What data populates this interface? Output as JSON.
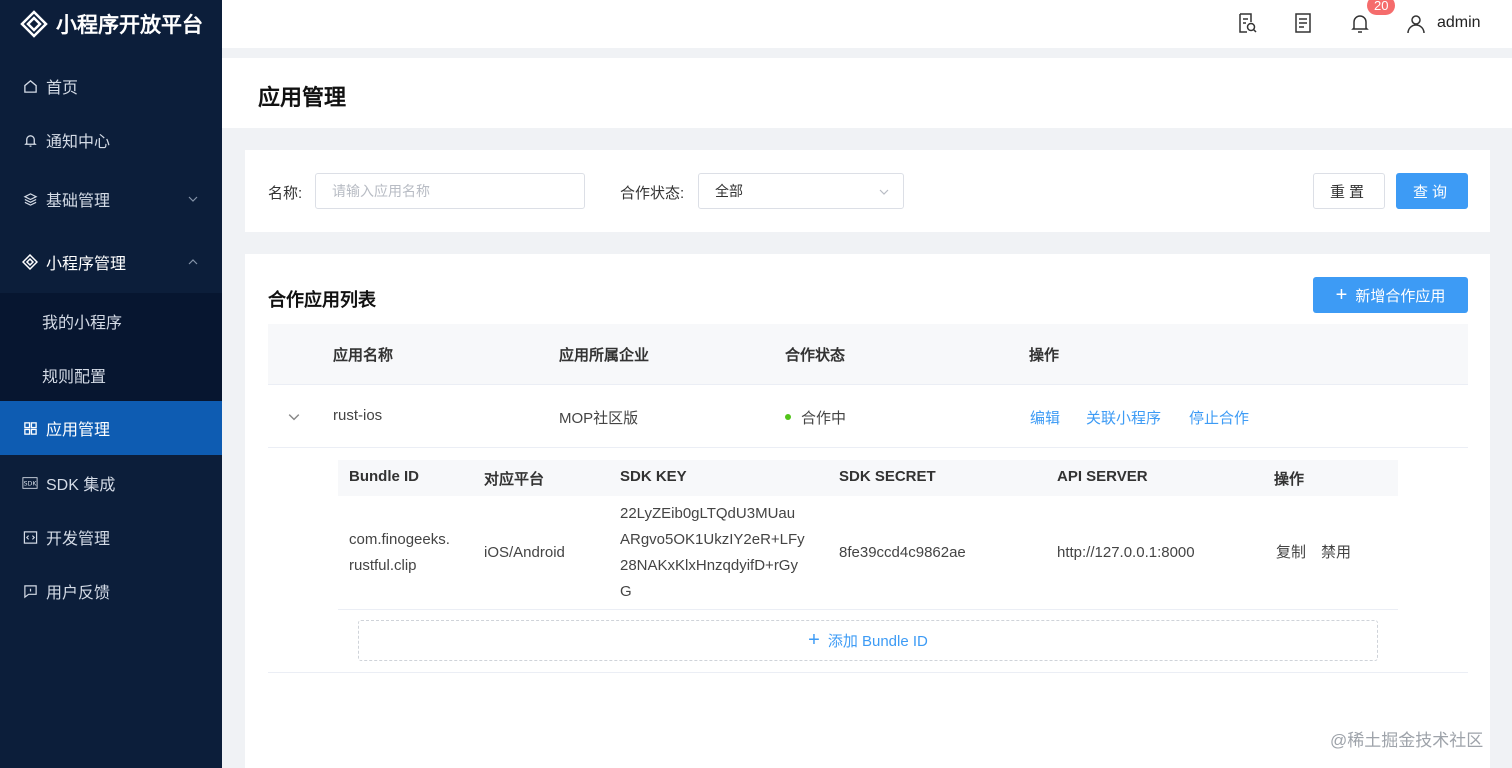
{
  "app": {
    "title": "小程序开放平台"
  },
  "sidebar": {
    "items": [
      {
        "label": "首页",
        "icon": "home-icon"
      },
      {
        "label": "通知中心",
        "icon": "bell-icon"
      },
      {
        "label": "基础管理",
        "icon": "layers-icon"
      },
      {
        "label": "小程序管理",
        "icon": "mini-program-icon"
      },
      {
        "label": "应用管理",
        "icon": "grid-icon"
      },
      {
        "label": "SDK 集成",
        "icon": "sdk-icon"
      },
      {
        "label": "开发管理",
        "icon": "code-icon"
      },
      {
        "label": "用户反馈",
        "icon": "feedback-icon"
      }
    ],
    "submenu": [
      "我的小程序",
      "规则配置"
    ]
  },
  "header": {
    "notification_count": "20",
    "username": "admin"
  },
  "page": {
    "title": "应用管理"
  },
  "filter": {
    "name_label": "名称:",
    "name_placeholder": "请输入应用名称",
    "status_label": "合作状态:",
    "status_value": "全部",
    "reset_label": "重置",
    "query_label": "查询"
  },
  "list": {
    "title": "合作应用列表",
    "add_label": "新增合作应用",
    "columns": [
      "应用名称",
      "应用所属企业",
      "合作状态",
      "操作"
    ],
    "row": {
      "name": "rust-ios",
      "company": "MOP社区版",
      "status": "合作中",
      "actions": [
        "编辑",
        "关联小程序",
        "停止合作"
      ]
    },
    "bundle_table": {
      "columns": [
        "Bundle ID",
        "对应平台",
        "SDK KEY",
        "SDK SECRET",
        "API SERVER",
        "操作"
      ],
      "row": {
        "bundle_id": [
          "com.finogeeks.",
          "rustful.clip"
        ],
        "platform": "iOS/Android",
        "sdk_key": [
          "22LyZEib0gLTQdU3MUau",
          "ARgvo5OK1UkzIY2eR+LFy",
          "28NAKxKlxHnzqdyifD+rGy",
          "G"
        ],
        "sdk_secret": "8fe39ccd4c9862ae",
        "api_server": "http://127.0.0.1:8000",
        "copy_label": "复制",
        "disable_label": "禁用"
      },
      "add_label": "添加 Bundle ID"
    }
  },
  "watermark": "@稀土掘金技术社区",
  "colors": {
    "sidebar_bg": "#0c1e3a",
    "active": "#0e5cb2",
    "primary": "#3d9bf5",
    "danger": "#f56c6c",
    "success": "#52c41a"
  }
}
